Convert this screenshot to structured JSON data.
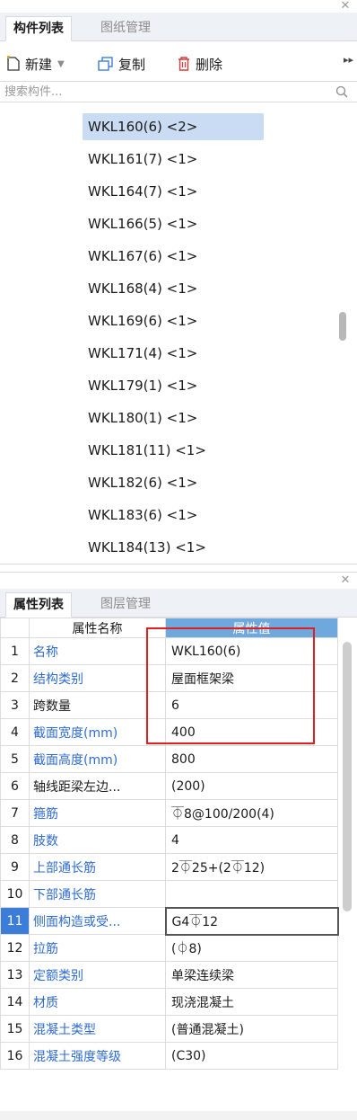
{
  "component_panel": {
    "tabs": [
      {
        "label": "构件列表",
        "active": true
      },
      {
        "label": "图纸管理",
        "active": false
      }
    ],
    "toolbar": {
      "new_label": "新建",
      "copy_label": "复制",
      "delete_label": "删除"
    },
    "search": {
      "placeholder": "搜索构件..."
    },
    "items": [
      {
        "label": "WKL160(6) <2>",
        "selected": true
      },
      {
        "label": "WKL161(7) <1>",
        "selected": false
      },
      {
        "label": "WKL164(7) <1>",
        "selected": false
      },
      {
        "label": "WKL166(5) <1>",
        "selected": false
      },
      {
        "label": "WKL167(6) <1>",
        "selected": false
      },
      {
        "label": "WKL168(4) <1>",
        "selected": false
      },
      {
        "label": "WKL169(6) <1>",
        "selected": false
      },
      {
        "label": "WKL171(4) <1>",
        "selected": false
      },
      {
        "label": "WKL179(1) <1>",
        "selected": false
      },
      {
        "label": "WKL180(1) <1>",
        "selected": false
      },
      {
        "label": "WKL181(11) <1>",
        "selected": false
      },
      {
        "label": "WKL182(6) <1>",
        "selected": false
      },
      {
        "label": "WKL183(6) <1>",
        "selected": false
      },
      {
        "label": "WKL184(13) <1>",
        "selected": false
      }
    ]
  },
  "property_panel": {
    "tabs": [
      {
        "label": "属性列表",
        "active": true
      },
      {
        "label": "图层管理",
        "active": false
      }
    ],
    "headers": {
      "name": "属性名称",
      "value": "属性值"
    },
    "rows": [
      {
        "num": "1",
        "name": "名称",
        "value": "WKL160(6)",
        "blue": true
      },
      {
        "num": "2",
        "name": "结构类别",
        "value": "屋面框架梁",
        "blue": true
      },
      {
        "num": "3",
        "name": "跨数量",
        "value": "6",
        "blue": false
      },
      {
        "num": "4",
        "name": "截面宽度(mm)",
        "value": "400",
        "blue": true
      },
      {
        "num": "5",
        "name": "截面高度(mm)",
        "value": "800",
        "blue": true
      },
      {
        "num": "6",
        "name": "轴线距梁左边...",
        "value": "(200)",
        "blue": false
      },
      {
        "num": "7",
        "name": "箍筋",
        "value": "⏁8@100/200(4)",
        "blue": true
      },
      {
        "num": "8",
        "name": "肢数",
        "value": "4",
        "blue": true
      },
      {
        "num": "9",
        "name": "上部通长筋",
        "value": "2⏁25+(2⏁12)",
        "blue": true
      },
      {
        "num": "10",
        "name": "下部通长筋",
        "value": "",
        "blue": true
      },
      {
        "num": "11",
        "name": "侧面构造或受...",
        "value": "G4⏁12",
        "blue": true,
        "selected": true
      },
      {
        "num": "12",
        "name": "拉筋",
        "value": "(⏀8)",
        "blue": true
      },
      {
        "num": "13",
        "name": "定额类别",
        "value": "单梁连续梁",
        "blue": true
      },
      {
        "num": "14",
        "name": "材质",
        "value": "现浇混凝土",
        "blue": true
      },
      {
        "num": "15",
        "name": "混凝土类型",
        "value": "(普通混凝土)",
        "blue": true
      },
      {
        "num": "16",
        "name": "混凝土强度等级",
        "value": "(C30)",
        "blue": true
      }
    ]
  },
  "colors": {
    "accent": "#3b7dd8",
    "selection": "#c9dcf3",
    "link_blue": "#2f6bcf",
    "highlight_box": "#e02020"
  }
}
